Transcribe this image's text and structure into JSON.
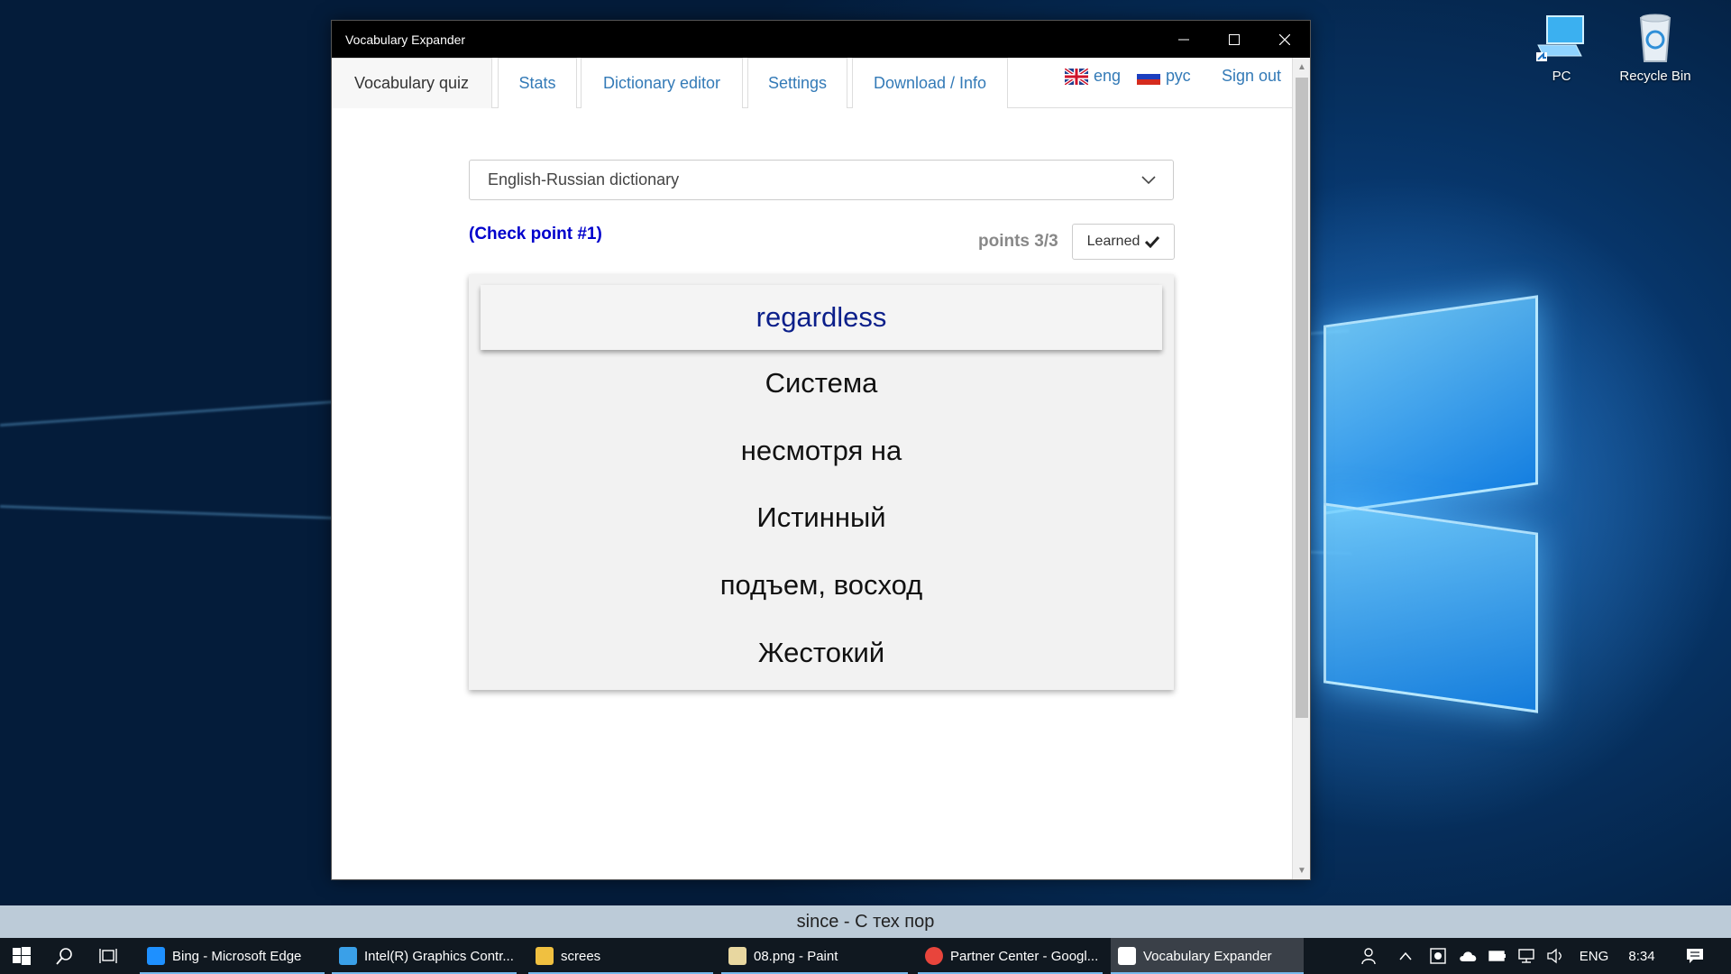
{
  "desktop": {
    "icons": [
      {
        "label": "PC",
        "icon": "computer-icon"
      },
      {
        "label": "Recycle Bin",
        "icon": "recycle-bin-icon"
      }
    ]
  },
  "window": {
    "title": "Vocabulary Expander",
    "controls": {
      "minimize": "minimize-icon",
      "maximize": "maximize-icon",
      "close": "close-icon"
    }
  },
  "nav": {
    "tabs": [
      {
        "label": "Vocabulary quiz",
        "active": true
      },
      {
        "label": "Stats",
        "active": false
      },
      {
        "label": "Dictionary editor",
        "active": false
      },
      {
        "label": "Settings",
        "active": false
      },
      {
        "label": "Download / Info",
        "active": false
      }
    ],
    "lang_eng": "eng",
    "lang_rus": "рус",
    "sign_out": "Sign out"
  },
  "quiz": {
    "dictionary": "English-Russian dictionary",
    "checkpoint": "(Check point #1)",
    "points": "points 3/3",
    "learned_label": "Learned",
    "word": "regardless",
    "answers": [
      "Система",
      "несмотря на",
      "Истинный",
      "подъем, восход",
      "Жестокий"
    ]
  },
  "status_strip": "since - С тех пор",
  "taskbar": {
    "tasks": [
      {
        "label": "Bing - Microsoft Edge",
        "icon": "edge-icon",
        "color": "#1e90ff"
      },
      {
        "label": "Intel(R) Graphics Contr...",
        "icon": "intel-graphics-icon",
        "color": "#3aa0e8"
      },
      {
        "label": "screes",
        "icon": "folder-icon",
        "color": "#f0c040"
      },
      {
        "label": "08.png - Paint",
        "icon": "paint-icon",
        "color": "#e8d7a0"
      },
      {
        "label": "Partner Center - Googl...",
        "icon": "chrome-icon",
        "color": "#e8453c"
      },
      {
        "label": "Vocabulary Expander",
        "icon": "vocabulary-expander-icon",
        "color": "#ffffff"
      }
    ],
    "language": "ENG",
    "time": "8:34"
  }
}
